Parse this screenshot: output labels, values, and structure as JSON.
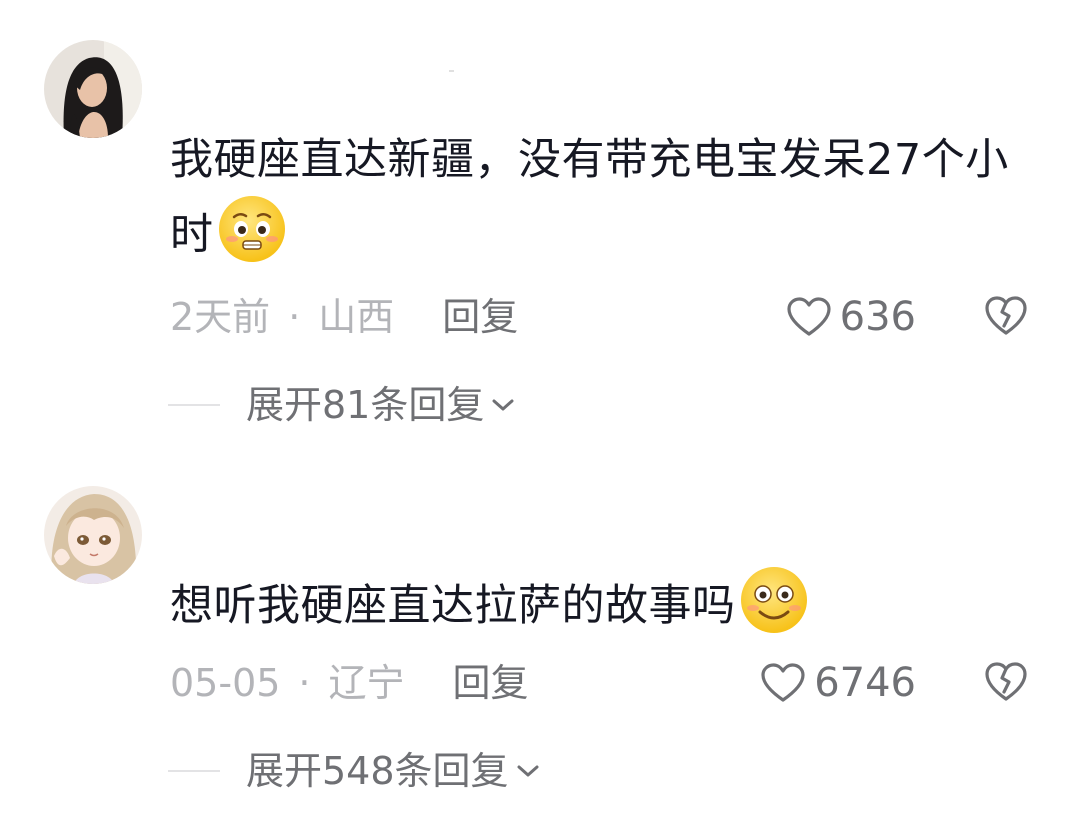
{
  "comments": [
    {
      "username": "",
      "text": "我硬座直达新疆，没有带充电宝发呆27个小时",
      "emoji": "pleading-face",
      "time": "2天前",
      "location": "山西",
      "reply_label": "回复",
      "likes": "636",
      "expand_label": "展开81条回复"
    },
    {
      "username": "",
      "text": "想听我硬座直达拉萨的故事吗",
      "emoji": "smiling-face",
      "time": "05-05",
      "location": "辽宁",
      "reply_label": "回复",
      "likes": "6746",
      "expand_label": "展开548条回复"
    }
  ],
  "meta_separator": "·",
  "colors": {
    "text": "#161823",
    "meta": "#b3b4b8",
    "secondary": "#6f7074",
    "emoji_yellow": "#ffd23b"
  }
}
